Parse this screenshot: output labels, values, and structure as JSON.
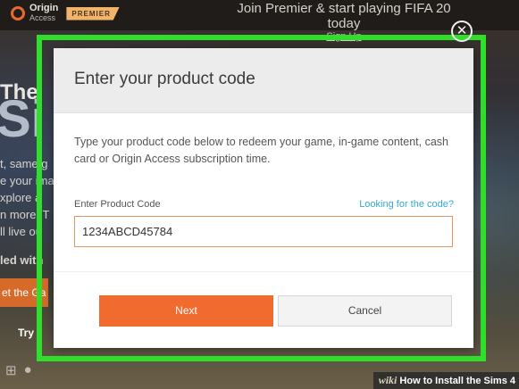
{
  "topbar": {
    "logo_name": "Origin",
    "logo_sub": "Access",
    "badge": "PREMIER",
    "promo_title": "Join Premier & start playing FIFA 20 today",
    "promo_link": "Sign Up"
  },
  "background": {
    "the": "The",
    "sims": "Si",
    "lines": [
      "t, same g",
      "e your ima",
      "xplore a",
      "n more. T",
      "ll live ou",
      "led with"
    ],
    "orange_button": "et the Ga",
    "try_text": "Try i"
  },
  "modal": {
    "title": "Enter your product code",
    "description": "Type your product code below to redeem your game, in-game content, cash card or Origin Access subscription time.",
    "field_label": "Enter Product Code",
    "help_link": "Looking for the code?",
    "code_value": "1234ABCD45784",
    "next_label": "Next",
    "cancel_label": "Cancel",
    "close_icon": "close-icon"
  },
  "watermark": {
    "wiki": "wiki",
    "text": "How to Install the Sims 4"
  },
  "colors": {
    "accent": "#f26b2e",
    "link": "#35a8d6",
    "highlight": "#2fe02a"
  }
}
